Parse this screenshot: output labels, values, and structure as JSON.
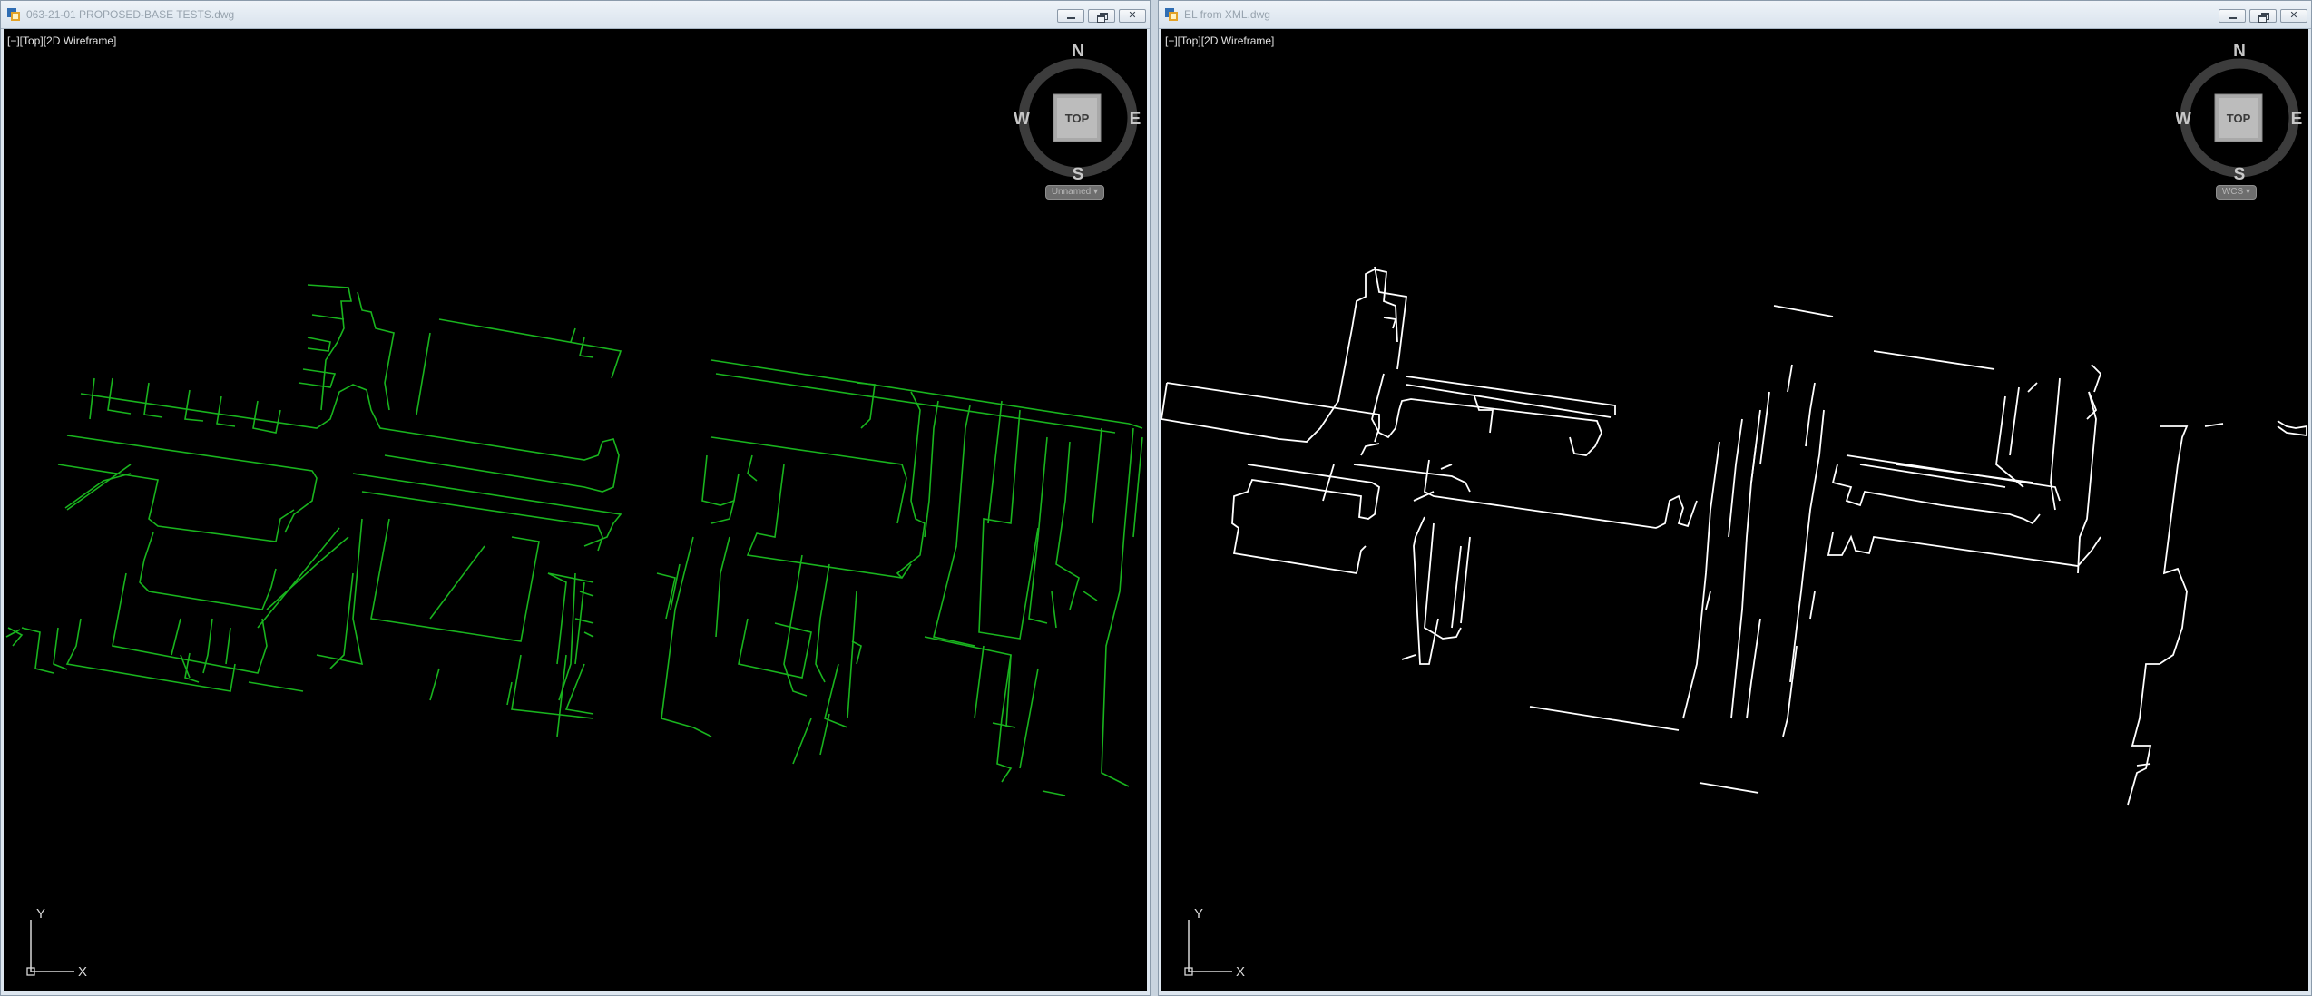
{
  "windows": [
    {
      "id": "left",
      "title": "063-21-01 PROPOSED-BASE TESTS.dwg",
      "viewport_label": "[−][Top][2D Wireframe]",
      "viewcube": {
        "top_face": "TOP",
        "north": "N",
        "south": "S",
        "east": "E",
        "west": "W"
      },
      "ucs_menu": "Unnamed",
      "ucs_axes": {
        "x": "X",
        "y": "Y"
      },
      "line_color": "#19b41e"
    },
    {
      "id": "right",
      "title": "EL from XML.dwg",
      "viewport_label": "[−][Top][2D Wireframe]",
      "viewcube": {
        "top_face": "TOP",
        "north": "N",
        "south": "S",
        "east": "E",
        "west": "W"
      },
      "ucs_menu": "WCS",
      "ucs_axes": {
        "x": "X",
        "y": "Y"
      },
      "line_color": "#ffffff"
    }
  ],
  "icons": {
    "app": "autocad-drawing-icon",
    "minimize": "minimize-icon",
    "restore": "restore-icon",
    "close": "close-icon"
  }
}
